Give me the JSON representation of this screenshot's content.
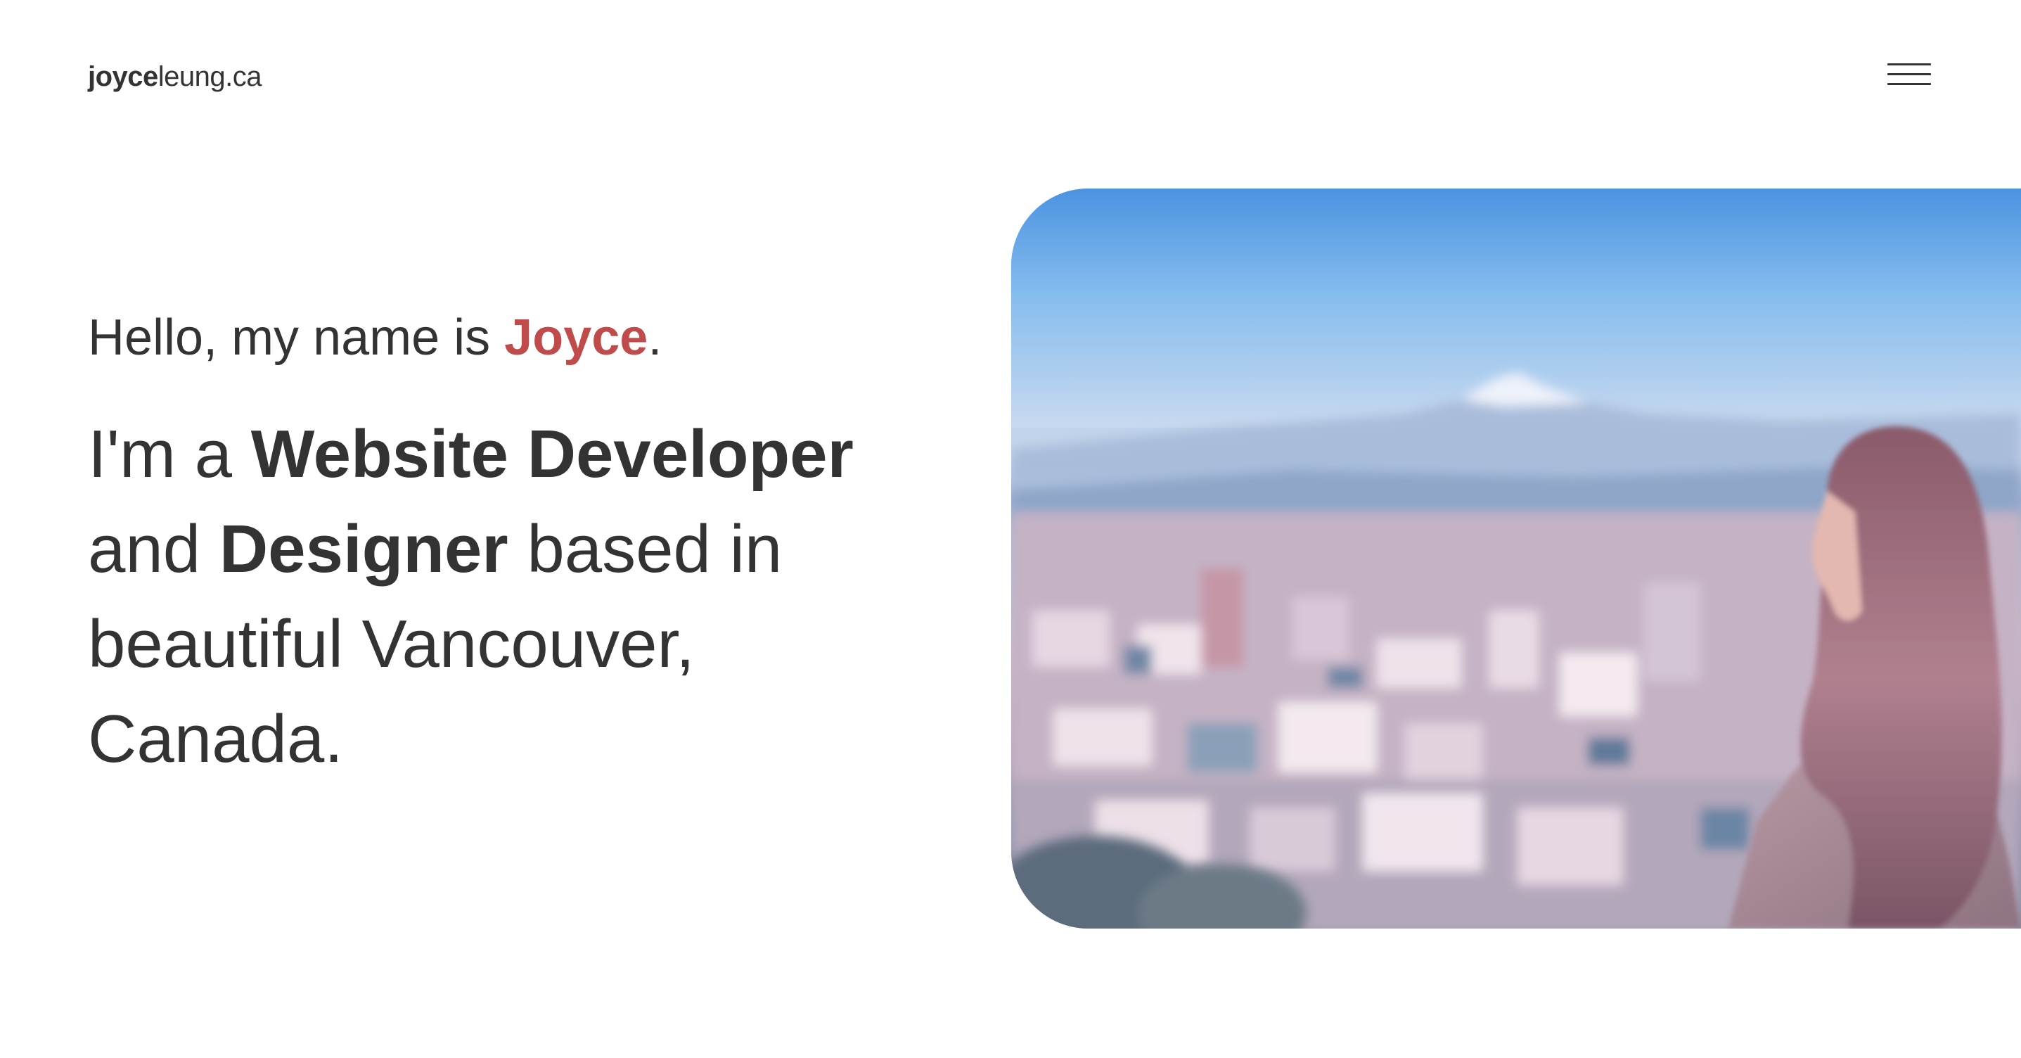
{
  "header": {
    "logo_bold": "joyce",
    "logo_light": "leung.ca",
    "menu_icon": "hamburger-menu-icon"
  },
  "hero": {
    "greeting_prefix": "Hello, my name is ",
    "greeting_name": "Joyce",
    "greeting_suffix": ".",
    "tagline_1": "I'm a ",
    "tagline_role_1": "Website Developer",
    "tagline_2": " and ",
    "tagline_role_2": "Designer",
    "tagline_3": " based in beautiful Vancouver, Canada.",
    "image_alt": "Joyce looking over a city with a snow-capped mountain in the distance"
  },
  "colors": {
    "text": "#333333",
    "accent": "#bf4b4b",
    "background": "#ffffff"
  }
}
